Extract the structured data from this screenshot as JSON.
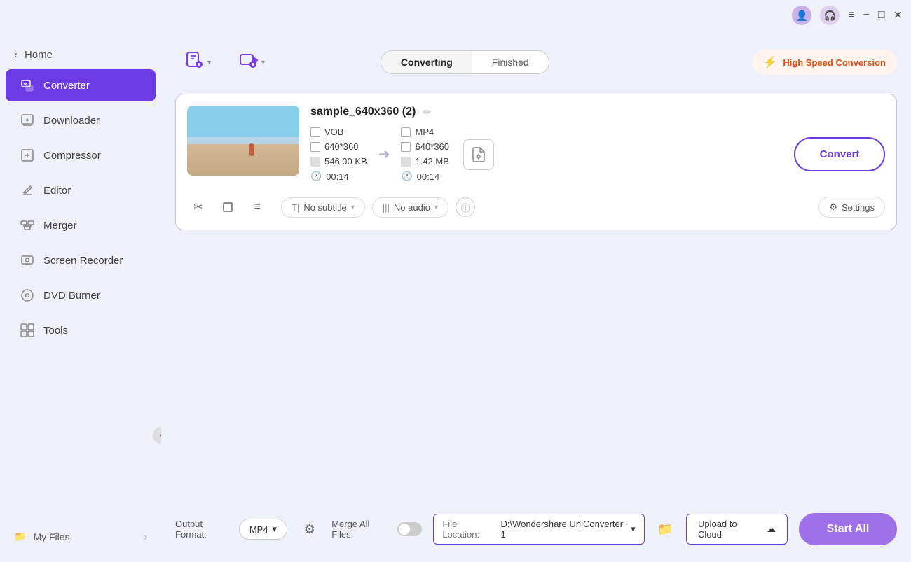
{
  "titlebar": {
    "minimize": "−",
    "maximize": "□",
    "close": "✕",
    "menu_icon": "≡"
  },
  "sidebar": {
    "home_label": "Home",
    "home_arrow": "‹",
    "items": [
      {
        "id": "converter",
        "label": "Converter",
        "icon": "🔄",
        "active": true
      },
      {
        "id": "downloader",
        "label": "Downloader",
        "icon": "⬇"
      },
      {
        "id": "compressor",
        "label": "Compressor",
        "icon": "🗜"
      },
      {
        "id": "editor",
        "label": "Editor",
        "icon": "✂"
      },
      {
        "id": "merger",
        "label": "Merger",
        "icon": "⊞"
      },
      {
        "id": "screen-recorder",
        "label": "Screen Recorder",
        "icon": "📷"
      },
      {
        "id": "dvd-burner",
        "label": "DVD Burner",
        "icon": "💿"
      },
      {
        "id": "tools",
        "label": "Tools",
        "icon": "⊞"
      }
    ],
    "my_files_label": "My Files",
    "my_files_arrow": "›",
    "collapse_icon": "‹"
  },
  "topbar": {
    "add_file_icon": "📄",
    "add_media_icon": "📷",
    "tabs": [
      {
        "id": "converting",
        "label": "Converting",
        "active": true
      },
      {
        "id": "finished",
        "label": "Finished"
      }
    ],
    "speed_label": "High Speed Conversion",
    "speed_icon": "⚡"
  },
  "file_card": {
    "title": "sample_640x360 (2)",
    "edit_icon": "✏",
    "source": {
      "format": "VOB",
      "resolution": "640*360",
      "size": "546.00 KB",
      "duration": "00:14"
    },
    "target": {
      "format": "MP4",
      "resolution": "640*360",
      "size": "1.42 MB",
      "duration": "00:14"
    },
    "arrow": "→",
    "convert_label": "Convert",
    "subtitle_label": "No subtitle",
    "audio_label": "No audio",
    "info_icon": "ⓘ",
    "settings_label": "Settings",
    "settings_gear_icon": "⚙",
    "file_settings_icon": "📄",
    "cut_icon": "✂",
    "crop_icon": "⬜",
    "effects_icon": "≡"
  },
  "bottom_bar": {
    "output_format_label": "Output Format:",
    "format_value": "MP4",
    "format_dropdown": "▾",
    "gear_icon": "⚙",
    "merge_label": "Merge All Files:",
    "file_location_label": "File Location:",
    "file_location_path": "D:\\Wondershare UniConverter 1",
    "file_location_dropdown": "▾",
    "folder_icon": "📁",
    "upload_cloud_label": "Upload to Cloud",
    "cloud_icon": "☁",
    "start_all_label": "Start All"
  }
}
